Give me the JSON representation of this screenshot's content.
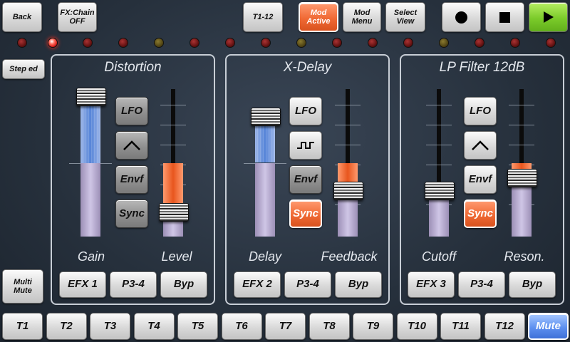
{
  "top": {
    "back": "Back",
    "fx_chain": "FX:Chain OFF",
    "t1_12": "T1-12",
    "mod_active": "Mod Active",
    "mod_menu": "Mod Menu",
    "select_view": "Select View"
  },
  "side": {
    "stepped": "Step ed",
    "multi_mute": "Multi Mute"
  },
  "panels": [
    {
      "title": "Distortion",
      "left_label": "Gain",
      "right_label": "Level",
      "buttons": {
        "mod1": "LFO",
        "mod3": "Envf",
        "mod4": "Sync"
      },
      "bottom": [
        "EFX 1",
        "P3-4",
        "Byp"
      ],
      "left_level": 1.0,
      "right_level": 0.18
    },
    {
      "title": "X-Delay",
      "left_label": "Delay",
      "right_label": "Feedback",
      "buttons": {
        "mod1": "LFO",
        "mod3": "Envf",
        "mod4": "Sync"
      },
      "bottom": [
        "EFX 2",
        "P3-4",
        "Byp"
      ],
      "left_level": 0.86,
      "right_level": 0.33
    },
    {
      "title": "LP Filter 12dB",
      "left_label": "Cutoff",
      "right_label": "Reson.",
      "buttons": {
        "mod1": "LFO",
        "mod3": "Envf",
        "mod4": "Sync"
      },
      "bottom": [
        "EFX 3",
        "P3-4",
        "Byp"
      ],
      "left_level": 0.33,
      "right_level": 0.42
    }
  ],
  "tracks": [
    "T1",
    "T2",
    "T3",
    "T4",
    "T5",
    "T6",
    "T7",
    "T8",
    "T9",
    "T10",
    "T11",
    "T12"
  ],
  "mute": "Mute"
}
